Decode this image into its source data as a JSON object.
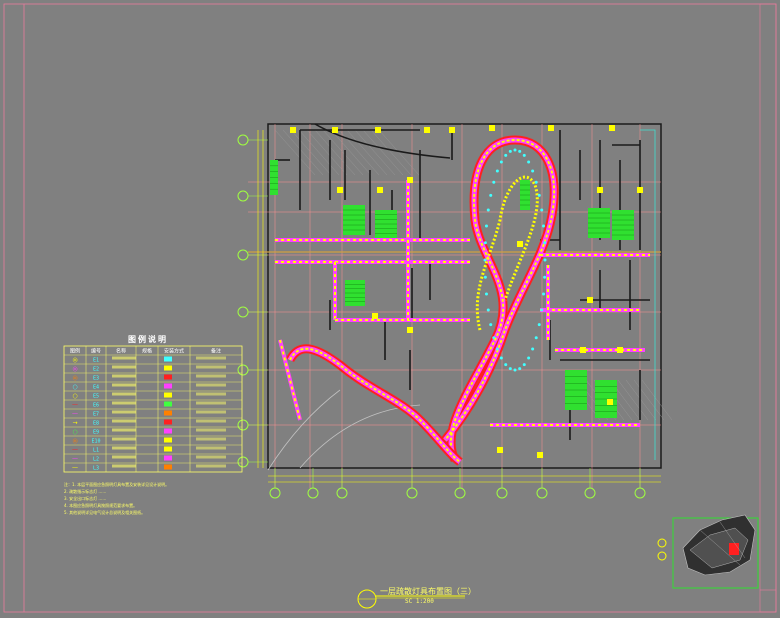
{
  "drawing": {
    "title": "一层疏散灯具布置图（三）",
    "scale": "SC 1:200",
    "legend_title": "图例说明"
  },
  "legend": {
    "headers": [
      "图例",
      "编号",
      "名称",
      "规格",
      "安装方式",
      "备注"
    ],
    "rows": [
      [
        "◎",
        "E1",
        "",
        "",
        "",
        ""
      ],
      [
        "◎",
        "E2",
        "",
        "",
        "",
        ""
      ],
      [
        "◎",
        "E3",
        "",
        "",
        "",
        ""
      ],
      [
        "○",
        "E4",
        "",
        "",
        "",
        ""
      ],
      [
        "○",
        "E5",
        "",
        "",
        "",
        ""
      ],
      [
        "—",
        "E6",
        "",
        "",
        "",
        ""
      ],
      [
        "—",
        "E7",
        "",
        "",
        "",
        ""
      ],
      [
        "→",
        "E8",
        "",
        "",
        "",
        ""
      ],
      [
        "○",
        "E9",
        "",
        "",
        "",
        ""
      ],
      [
        "◎",
        "E10",
        "",
        "",
        "",
        ""
      ],
      [
        "—",
        "L1",
        "",
        "",
        "",
        ""
      ],
      [
        "—",
        "L2",
        "",
        "",
        "",
        ""
      ],
      [
        "—",
        "L3",
        "",
        "",
        "",
        ""
      ]
    ]
  },
  "notes": [
    "注：1. 本层平面图应急照明灯具布置及安装详见设计说明。",
    "2. 疏散指示标志灯 ……",
    "3. 安全出口标志灯 ……",
    "4. 本图应急照明灯具按照规范要求布置。",
    "5. 其他说明详见电气设计总说明及相关图纸。"
  ],
  "colors": {
    "background": "#808080",
    "frame": "#e87a9c",
    "grid": "#ff9090",
    "axis": "#ffff00",
    "axis_bubble": "#a0ff40",
    "wall": "#1a1a1a",
    "route_red": "#ff2020",
    "route_yellow": "#ffff00",
    "route_magenta": "#ff40ff",
    "stair": "#30e030",
    "door": "#ffff00"
  },
  "icons": {
    "north_symbol": "section-circle-icon",
    "key_plan": "key-plan-thumbnail"
  }
}
